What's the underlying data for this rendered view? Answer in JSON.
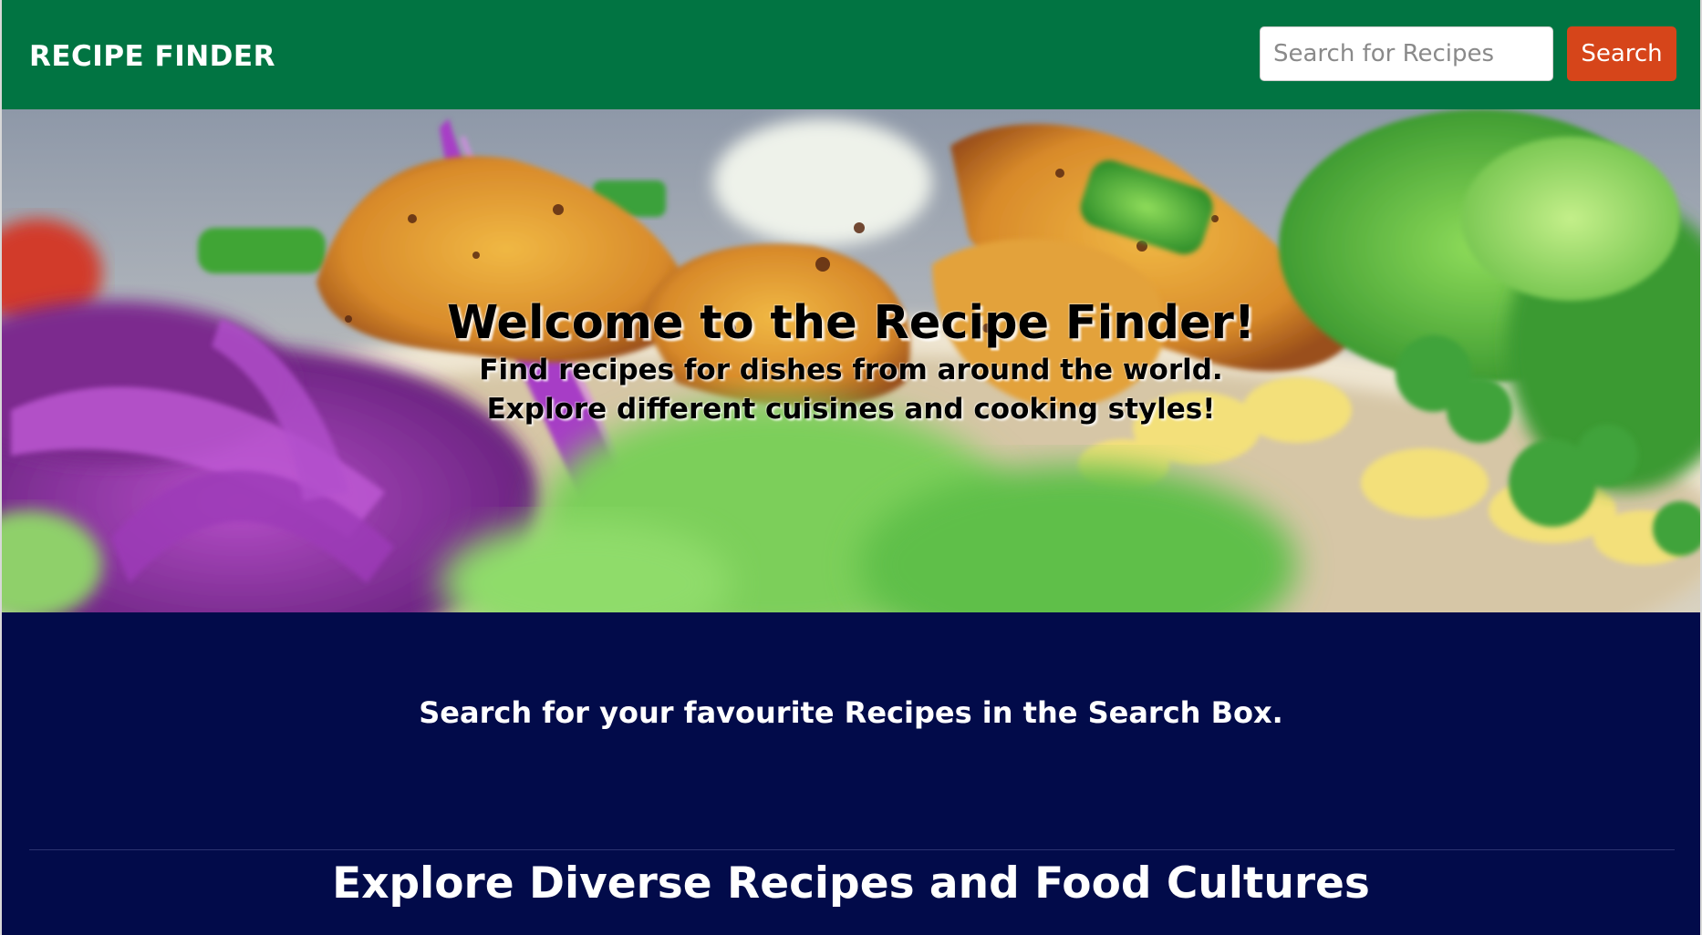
{
  "header": {
    "brand": "RECIPE FINDER",
    "search_placeholder": "Search for Recipes",
    "search_button": "Search",
    "colors": {
      "bar": "#017442",
      "button": "#d6451a"
    }
  },
  "hero": {
    "title": "Welcome to the Recipe Finder!",
    "subtitle_line1": "Find recipes for dishes from around the world.",
    "subtitle_line2": "Explore different cuisines and cooking styles!",
    "image": "salad-bowl-photo"
  },
  "main": {
    "hint": "Search for your favourite Recipes in the Search Box.",
    "section_heading": "Explore Diverse Recipes and Food Cultures",
    "colors": {
      "background": "#020b4a",
      "text": "#ffffff"
    }
  }
}
